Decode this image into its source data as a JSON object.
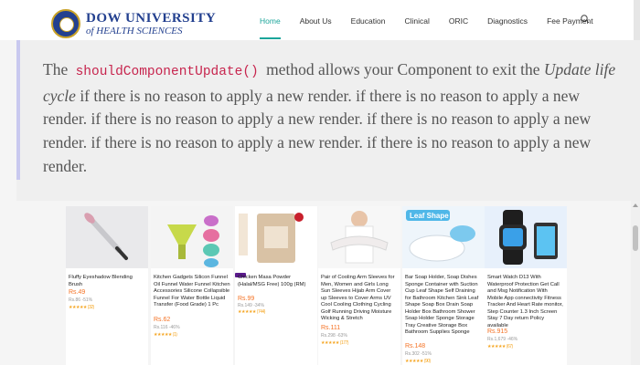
{
  "header": {
    "logo": {
      "line1": "DOW UNIVERSITY",
      "line2": "of HEALTH SCIENCES"
    },
    "nav": [
      "Home",
      "About Us",
      "Education",
      "Clinical",
      "ORIC",
      "Diagnostics",
      "Fee Payment"
    ],
    "active_nav": "Home",
    "accent_color": "#1ba59a",
    "brand_color": "#23408f",
    "search_icon": "search-icon"
  },
  "quote": {
    "prefix": "The",
    "code": "shouldComponentUpdate()",
    "middle": "method allows your Component to exit the",
    "emph": "Update life cycle",
    "rest": "if there is no reason to apply a new render. if there is no reason to apply a new render. if there is no reason to apply a new render. if there is no reason to apply a new render. if there is no reason to apply a new render. if there is no reason to apply a new render.",
    "code_color": "#c7254e",
    "bar_color": "#c9c9ef"
  },
  "products": [
    {
      "title": "Fluffy Eyeshadow Blending Brush",
      "price": "Rs.49",
      "old": "Rs.86 -51%",
      "rating": "★★★★★ (32)"
    },
    {
      "title": "Kitchen Gadgets Silicon Funnel Oil Funnel Water Funnel Kitchen Accessories Silicone Collapsible Funnel For Water Bottle Liquid Transfer (Food Grade) 1 Pc",
      "price": "Rs.62",
      "old": "Rs.116 -46%",
      "rating": "★★★★★ (1)"
    },
    {
      "title": "Chicken Masa Powder (Halal/MSG Free) 100g (RM)",
      "price": "Rs.99",
      "old": "Rs.149 -34%",
      "rating": "★★★★★ (744)"
    },
    {
      "title": "Pair of Cooling Arm Sleeves for Men, Women and Girls Long Sun Sleeves Hijab Arm Cover up Sleeves to Cover Arms UV Cool Cooling Clothing Cycling Golf Running Driving Moisture Wicking & Stretch",
      "price": "Rs.111",
      "old": "Rs.298 -63%",
      "rating": "★★★★★ (177)"
    },
    {
      "title": "Bar Soap Holder, Soap Dishes Sponge Container with Suction Cup Leaf Shape Self Draining for Bathroom Kitchen Sink Leaf Shape Soap Box Drain Soap Holder Box Bathroom Shower Soap Holder Sponge Storage Tray Creative Storage Box Bathroom Supplies Sponge",
      "price": "Rs.148",
      "old": "Rs.302 -51%",
      "rating": "★★★★★ (90)",
      "banner": "Leaf Shape"
    },
    {
      "title": "Smart Watch D13 With Waterproof Protection Get Call and Msg Notification With Mobile App connectivity Fitness Tracker And Heart Rate monitor, Step Counter 1.3 Inch Screen Stay 7 Day return Policy available",
      "price": "Rs.915",
      "old": "Rs.1,679 -46%",
      "rating": "★★★★★ (67)"
    }
  ]
}
